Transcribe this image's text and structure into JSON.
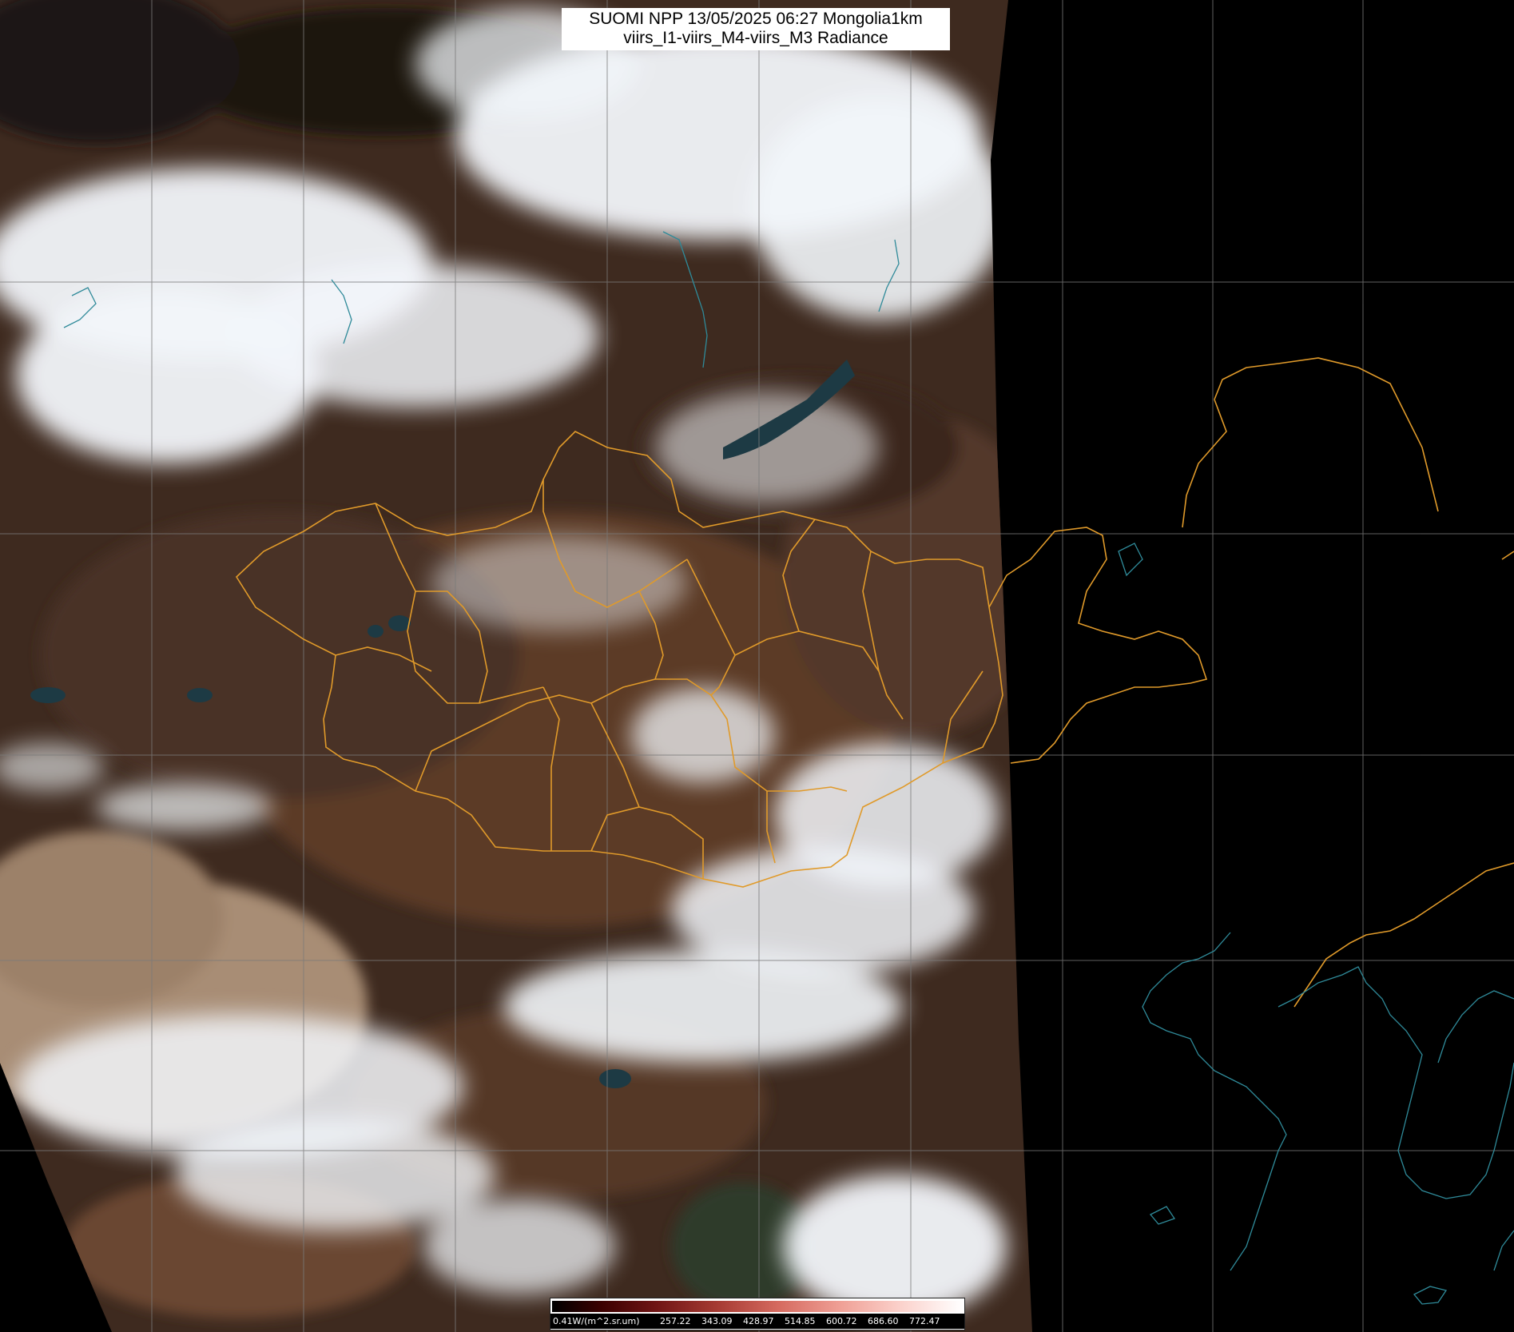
{
  "title": {
    "line1": "SUOMI NPP 13/05/2025 06:27 Mongolia1km",
    "line2": "viirs_I1-viirs_M4-viirs_M3 Radiance"
  },
  "colorbar": {
    "unit_label": "0.41W/(m^2.sr.um)",
    "tick_labels": [
      "257.22",
      "343.09",
      "428.97",
      "514.85",
      "600.72",
      "686.60",
      "772.47"
    ],
    "colors": [
      "#000000",
      "#6e1414",
      "#d56a5f",
      "#ffffff"
    ]
  },
  "map": {
    "colors": {
      "background": "#000000",
      "land_brown": "#5b3a27",
      "land_dark": "#2a1c15",
      "desert_tan": "#a88d74",
      "cloud_white": "#f2f6fa",
      "admin_border": "#e09a2a",
      "coastline": "#2f8a99",
      "graticule": "#7a7a7a"
    }
  }
}
